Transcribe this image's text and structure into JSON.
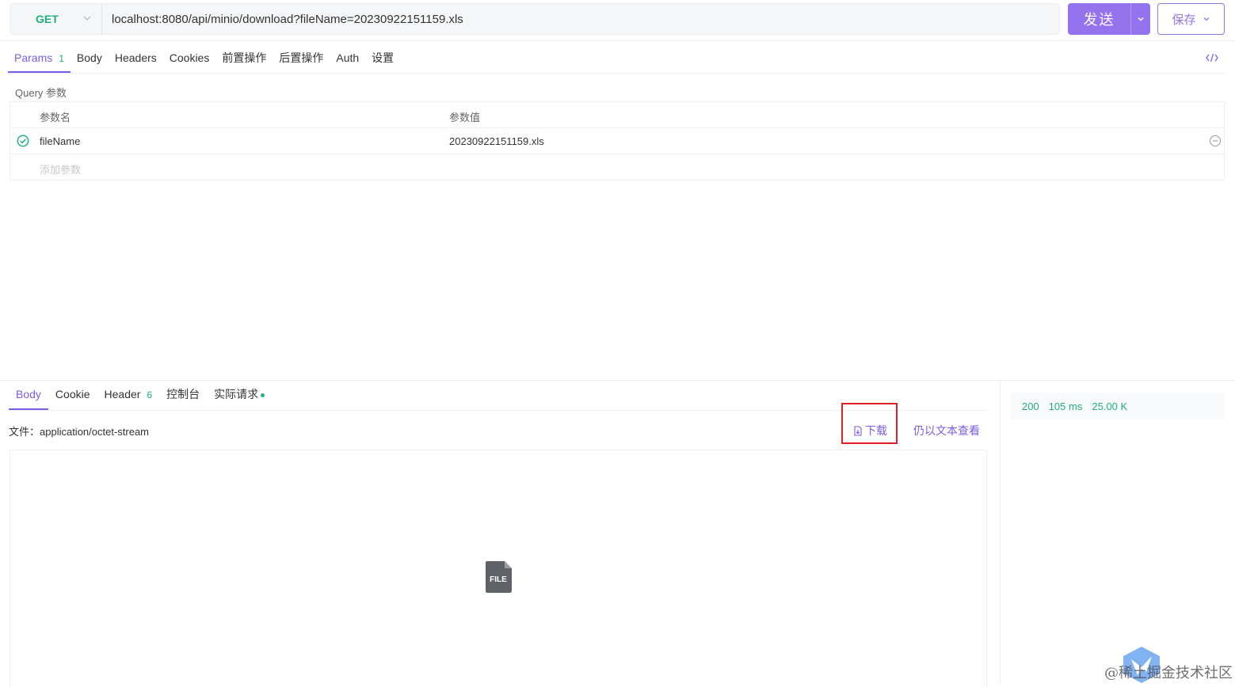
{
  "request": {
    "method": "GET",
    "url": "localhost:8080/api/minio/download?fileName=20230922151159.xls",
    "send_label": "发送",
    "save_label": "保存"
  },
  "request_tabs": [
    {
      "label": "Params",
      "count": "1",
      "active": true
    },
    {
      "label": "Body"
    },
    {
      "label": "Headers"
    },
    {
      "label": "Cookies"
    },
    {
      "label": "前置操作"
    },
    {
      "label": "后置操作"
    },
    {
      "label": "Auth"
    },
    {
      "label": "设置"
    }
  ],
  "query": {
    "section_label": "Query 参数",
    "col_name": "参数名",
    "col_value": "参数值",
    "rows": [
      {
        "name": "fileName",
        "value": "20230922151159.xls",
        "enabled": true
      }
    ],
    "add_placeholder": "添加参数"
  },
  "response_tabs": [
    {
      "label": "Body",
      "active": true
    },
    {
      "label": "Cookie"
    },
    {
      "label": "Header",
      "count": "6"
    },
    {
      "label": "控制台"
    },
    {
      "label": "实际请求",
      "dot": true
    }
  ],
  "response": {
    "file_type": "文件：application/octet-stream",
    "download_label": "下载",
    "view_as_text_label": "仍以文本查看",
    "file_icon_label": "FILE",
    "status": "200",
    "time": "105 ms",
    "size": "25.00 K"
  },
  "watermark": "@稀土掘金技术社区",
  "colors": {
    "accent": "#7c5ce8",
    "send_button": "#9373ee",
    "success": "#20b07a",
    "highlight_box": "#e02020"
  }
}
